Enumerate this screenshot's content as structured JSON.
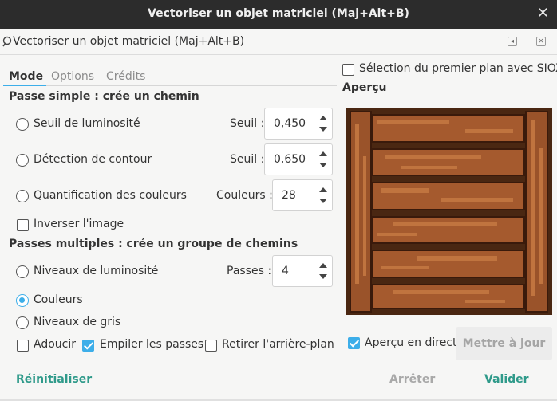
{
  "window": {
    "title": "Vectoriser un objet matriciel (Maj+Alt+B)",
    "close_glyph": "✕"
  },
  "dialog": {
    "title": "Vectoriser un objet matriciel (Maj+Alt+B)",
    "icon": "trace-bitmap-icon",
    "collapse_glyph": "◂",
    "close_glyph": "✕"
  },
  "tabs": [
    {
      "label": "Mode",
      "active": true
    },
    {
      "label": "Options",
      "active": false
    },
    {
      "label": "Crédits",
      "active": false
    }
  ],
  "single_scan": {
    "title": "Passe simple : crée un chemin",
    "options": [
      {
        "label": "Seuil de luminosité",
        "selected": false,
        "param_label": "Seuil :",
        "param_value": "0,450"
      },
      {
        "label": "Détection de contour",
        "selected": false,
        "param_label": "Seuil :",
        "param_value": "0,650"
      },
      {
        "label": "Quantification des couleurs",
        "selected": false,
        "param_label": "Couleurs :",
        "param_value": "28"
      }
    ],
    "invert": {
      "label": "Inverser l'image",
      "checked": false
    }
  },
  "multi_scan": {
    "title": "Passes multiples : crée un groupe de chemins",
    "options": [
      {
        "label": "Niveaux de luminosité",
        "selected": false,
        "param_label": "Passes :",
        "param_value": "4"
      },
      {
        "label": "Couleurs",
        "selected": true
      },
      {
        "label": "Niveaux de gris",
        "selected": false
      }
    ],
    "smooth": {
      "label": "Adoucir",
      "checked": false
    },
    "stack": {
      "label": "Empiler les passes",
      "checked": true
    },
    "remove_bg": {
      "label": "Retirer l'arrière-plan",
      "checked": false
    }
  },
  "siox": {
    "label": "Sélection du premier plan avec SIOX",
    "checked": false
  },
  "preview": {
    "title": "Aperçu",
    "live": {
      "label": "Aperçu en direct",
      "checked": true
    },
    "update_label": "Mettre à jour",
    "colors": {
      "frame": "#4a2712",
      "plank": "#a55a2e",
      "plank_light": "#c0743f",
      "groove": "#3a1a0b"
    }
  },
  "footer": {
    "reset": "Réinitialiser",
    "stop": "Arrêter",
    "ok": "Valider"
  },
  "colors": {
    "accent": "#3daee9",
    "footer_action": "#2f9a8a",
    "disabled": "#a9a9a9",
    "titlebar": "#2c2c2c"
  }
}
